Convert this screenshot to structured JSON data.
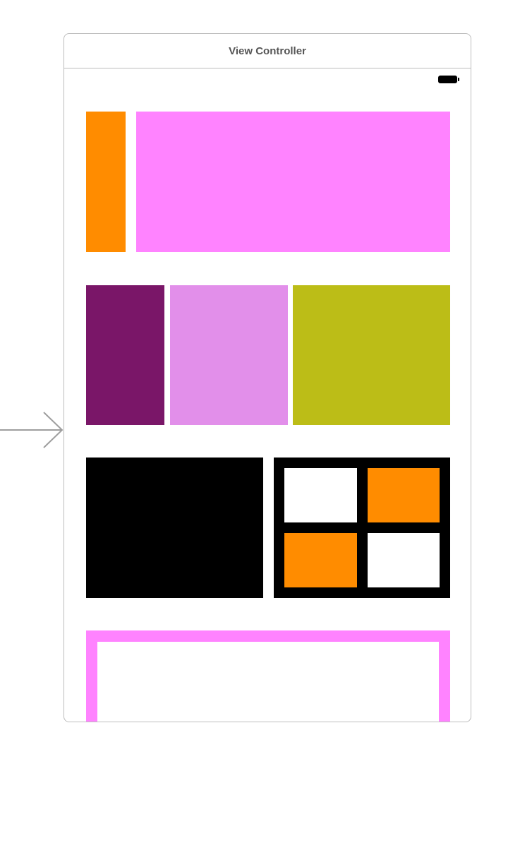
{
  "scene": {
    "title": "View Controller"
  },
  "icons": {
    "entry_point": "entry-point-arrow-icon",
    "battery": "battery-icon"
  },
  "colors": {
    "orange": "#FF8C00",
    "magenta": "#FF83FF",
    "dark_purple": "#7A1668",
    "light_purple": "#E28FEA",
    "olive": "#BCBD17",
    "black": "#000000",
    "white": "#FFFFFF"
  }
}
